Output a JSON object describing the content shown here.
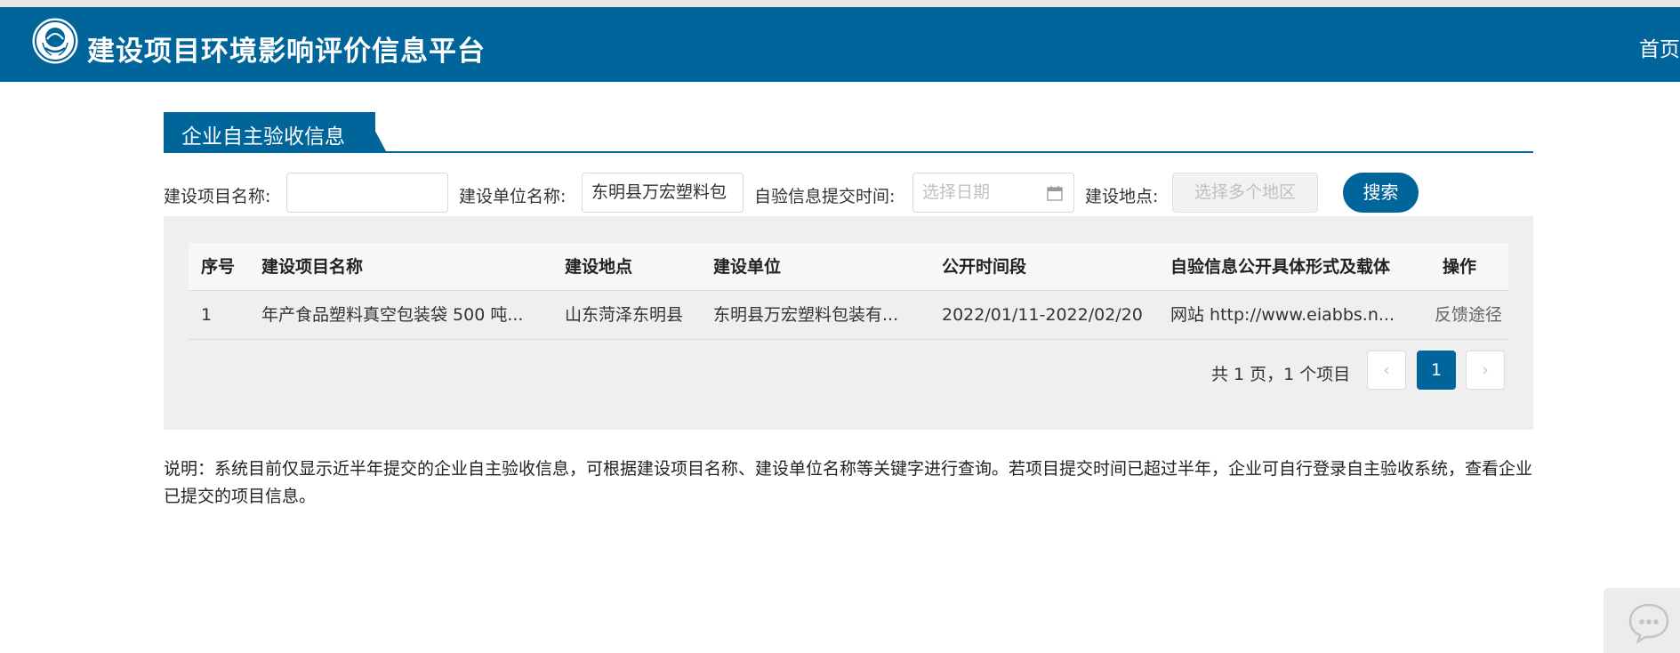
{
  "header": {
    "title": "建设项目环境影响评价信息平台",
    "nav_home": "首页",
    "logo_icon": "mee-emblem-icon",
    "bg_color": "#00659b"
  },
  "section": {
    "title": "企业自主验收信息"
  },
  "search": {
    "project_name_label": "建设项目名称:",
    "project_name_value": "",
    "unit_name_label": "建设单位名称:",
    "unit_name_value": "东明县万宏塑料包",
    "submit_time_label": "自验信息提交时间:",
    "submit_time_placeholder": "选择日期",
    "location_label": "建设地点:",
    "location_placeholder": "选择多个地区",
    "search_button": "搜索"
  },
  "table": {
    "columns": [
      "序号",
      "建设项目名称",
      "建设地点",
      "建设单位",
      "公开时间段",
      "自验信息公开具体形式及载体",
      "操作"
    ],
    "rows": [
      {
        "index": "1",
        "project": "年产食品塑料真空包装袋 500 吨...",
        "location": "山东菏泽东明县",
        "unit": "东明县万宏塑料包装有...",
        "period": "2022/01/11-2022/02/20",
        "carrier": "网站 http://www.eiabbs.n...",
        "action": "反馈途径"
      }
    ]
  },
  "pager": {
    "summary": "共 1 页，1 个项目",
    "prev": "‹",
    "current": "1",
    "next": "›"
  },
  "note": {
    "text": "说明：系统目前仅显示近半年提交的企业自主验收信息，可根据建设项目名称、建设单位名称等关键字进行查询。若项目提交时间已超过半年，企业可自行登录自主验收系统，查看企业已提交的项目信息。"
  },
  "chat": {
    "icon": "chat-bubble-icon"
  }
}
